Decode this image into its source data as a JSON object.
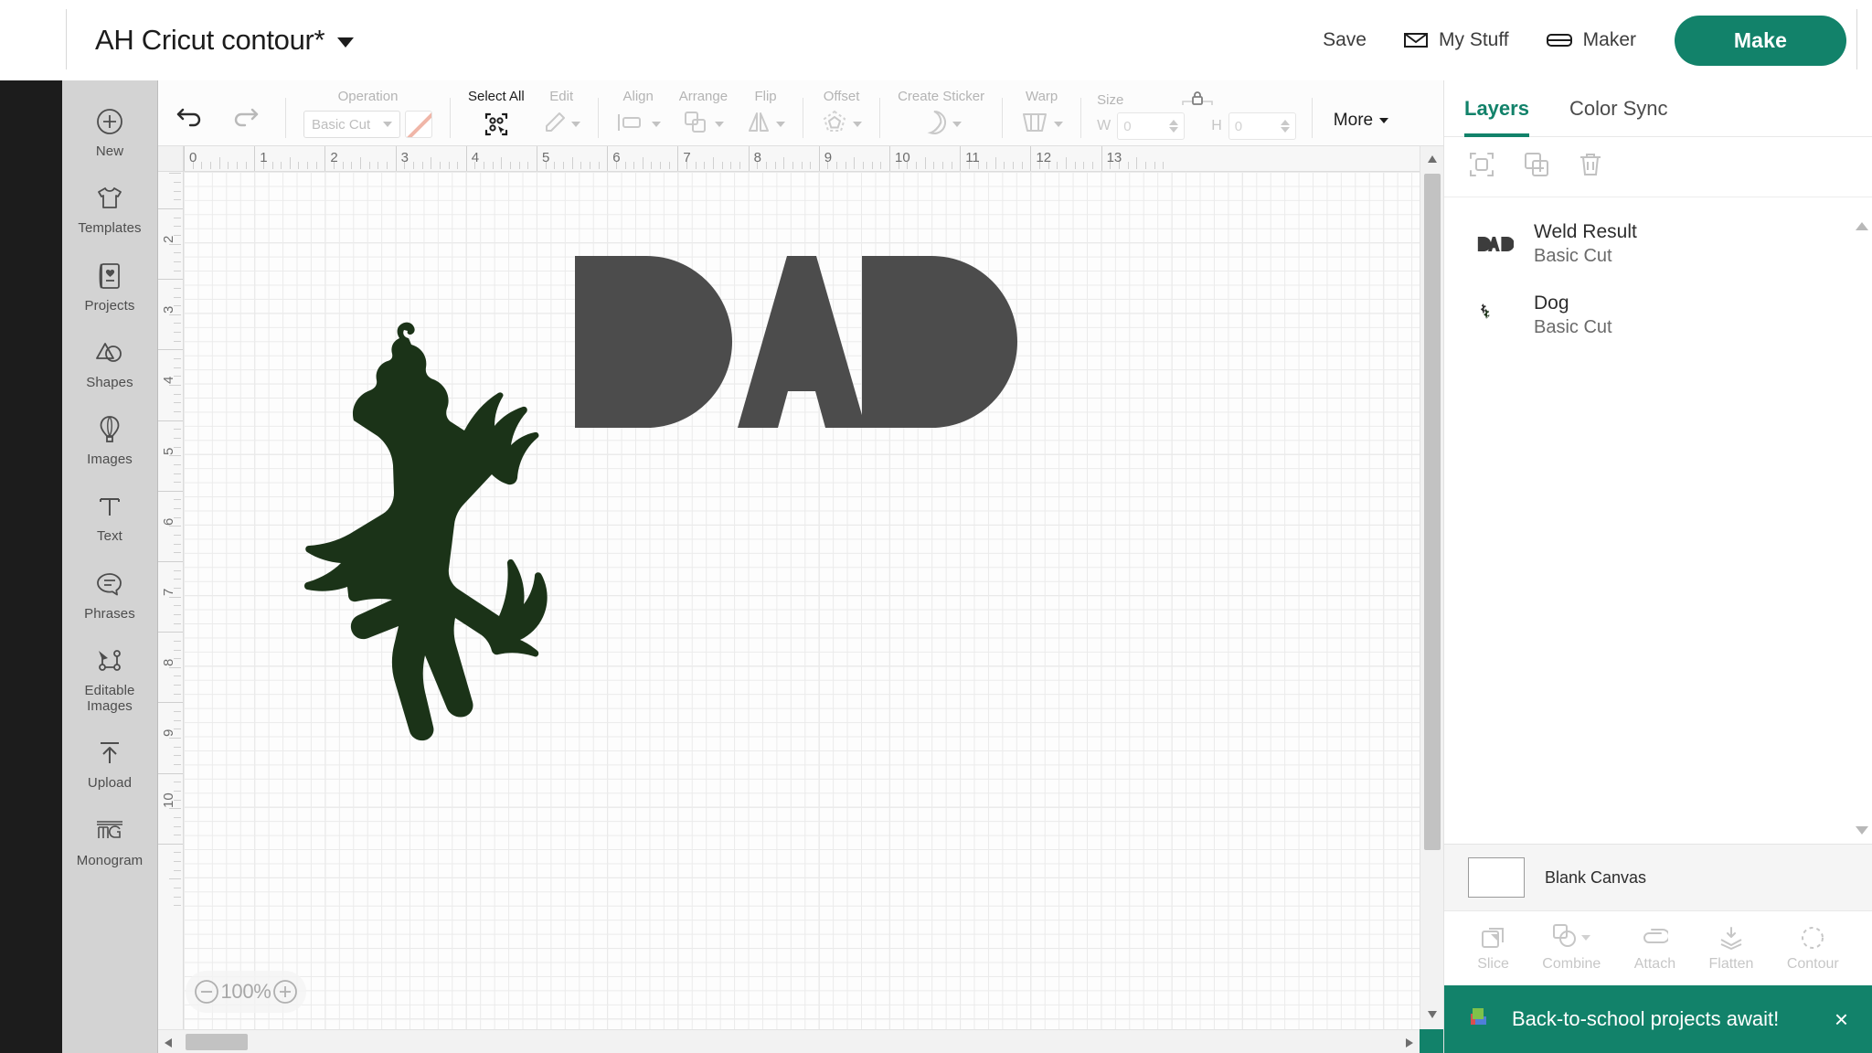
{
  "header": {
    "doc_title": "AH Cricut contour*",
    "save_label": "Save",
    "my_stuff_label": "My Stuff",
    "machine_label": "Maker",
    "make_label": "Make",
    "accent_color": "#12826a"
  },
  "rail": {
    "items": [
      {
        "label": "New",
        "icon": "plus-circle-icon"
      },
      {
        "label": "Templates",
        "icon": "tshirt-icon"
      },
      {
        "label": "Projects",
        "icon": "card-heart-icon"
      },
      {
        "label": "Shapes",
        "icon": "shapes-icon"
      },
      {
        "label": "Images",
        "icon": "hot-air-balloon-icon"
      },
      {
        "label": "Text",
        "icon": "text-t-icon"
      },
      {
        "label": "Phrases",
        "icon": "speech-bubble-icon"
      },
      {
        "label": "Editable Images",
        "icon": "editable-image-icon"
      },
      {
        "label": "Upload",
        "icon": "upload-arrow-icon"
      },
      {
        "label": "Monogram",
        "icon": "monogram-icon"
      }
    ]
  },
  "toolbar": {
    "undo_icon": "undo-icon",
    "redo_icon": "redo-icon",
    "operation_label": "Operation",
    "operation_value": "Basic Cut",
    "color_swatch_label": "",
    "select_all_label": "Select All",
    "edit_label": "Edit",
    "align_label": "Align",
    "arrange_label": "Arrange",
    "flip_label": "Flip",
    "offset_label": "Offset",
    "create_sticker_label": "Create Sticker",
    "warp_label": "Warp",
    "size_label": "Size",
    "width_label": "W",
    "width_value": "0",
    "height_label": "H",
    "height_value": "0",
    "lock_icon": "lock-icon",
    "more_label": "More"
  },
  "canvas": {
    "zoom_value": "100%",
    "zoom_out_icon": "minus-circle-icon",
    "zoom_in_icon": "plus-circle-icon",
    "ruler_h_numbers": [
      "0",
      "1",
      "2",
      "3",
      "4",
      "5",
      "6",
      "7",
      "8",
      "9",
      "10",
      "11",
      "12",
      "13"
    ],
    "ruler_v_numbers": [
      "2",
      "3",
      "4",
      "5",
      "6",
      "7",
      "8",
      "9",
      "10"
    ],
    "artwork": [
      {
        "name": "dog-silhouette",
        "color": "#1b3318"
      },
      {
        "name": "dad-weld-text",
        "color": "#4c4c4c",
        "text": "DAD"
      }
    ]
  },
  "panel": {
    "tabs": [
      {
        "label": "Layers",
        "active": true
      },
      {
        "label": "Color Sync",
        "active": false
      }
    ],
    "tools": [
      {
        "name": "group-icon"
      },
      {
        "name": "duplicate-icon"
      },
      {
        "name": "delete-icon"
      }
    ],
    "layers": [
      {
        "name": "Weld Result",
        "operation": "Basic Cut",
        "thumb": "dad-thumb"
      },
      {
        "name": "Dog",
        "operation": "Basic Cut",
        "thumb": "dog-thumb"
      }
    ],
    "canvas_row": {
      "label": "Blank Canvas",
      "color": "#ffffff"
    },
    "operations": [
      {
        "label": "Slice",
        "icon": "slice-icon",
        "has_caret": false
      },
      {
        "label": "Combine",
        "icon": "combine-icon",
        "has_caret": true
      },
      {
        "label": "Attach",
        "icon": "attach-icon",
        "has_caret": false
      },
      {
        "label": "Flatten",
        "icon": "flatten-icon",
        "has_caret": false
      },
      {
        "label": "Contour",
        "icon": "contour-icon",
        "has_caret": false
      }
    ],
    "toast": {
      "message": "Back-to-school projects await!",
      "icon": "projects-stack-icon",
      "close": "×"
    }
  }
}
